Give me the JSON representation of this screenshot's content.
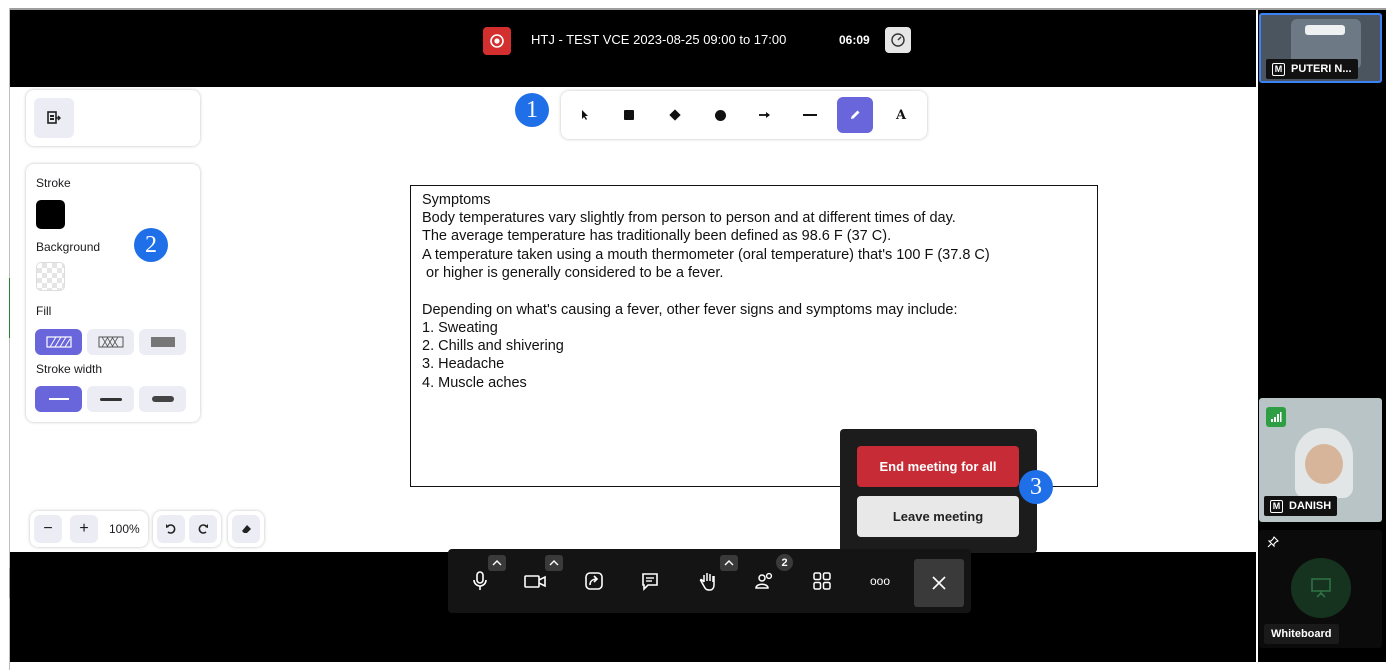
{
  "meeting": {
    "title": "HTJ - TEST VCE 2023-08-25 09:00 to 17:00",
    "timer": "06:09"
  },
  "whiteboard": {
    "props": {
      "stroke_label": "Stroke",
      "background_label": "Background",
      "fill_label": "Fill",
      "stroke_width_label": "Stroke width",
      "stroke_color": "#000000",
      "selected_fill": "hachure",
      "selected_stroke_width": "thin"
    },
    "toolbar_tools": [
      "selection",
      "rectangle",
      "diamond",
      "ellipse",
      "arrow",
      "line",
      "draw",
      "text"
    ],
    "active_tool": "draw",
    "text_tool_label": "A",
    "zoom": "100%",
    "text_lines": [
      "Symptoms",
      "Body temperatures vary slightly from person to person and at different times of day.",
      "The average temperature has traditionally been defined as 98.6 F (37 C).",
      "A temperature taken using a mouth thermometer (oral temperature) that's 100 F (37.8 C)",
      " or higher is generally considered to be a fever.",
      "",
      "Depending on what's causing a fever, other fever signs and symptoms may include:",
      "1. Sweating",
      "2. Chills and shivering",
      "3. Headache",
      "4. Muscle aches"
    ]
  },
  "annotations": [
    "1",
    "2",
    "3"
  ],
  "leave_popup": {
    "end_label": "End meeting for all",
    "leave_label": "Leave meeting"
  },
  "controls": {
    "participant_count": "2",
    "more_label": "ooo"
  },
  "participants": [
    {
      "badge": "M",
      "name": "PUTERI N..."
    },
    {
      "badge": "M",
      "name": "DANISH"
    }
  ],
  "whiteboard_tile": {
    "label": "Whiteboard"
  },
  "colors": {
    "accent": "#6965db",
    "end_button": "#c62b36",
    "record": "#d32f2f",
    "annotation_badge": "#1e6fe8"
  }
}
